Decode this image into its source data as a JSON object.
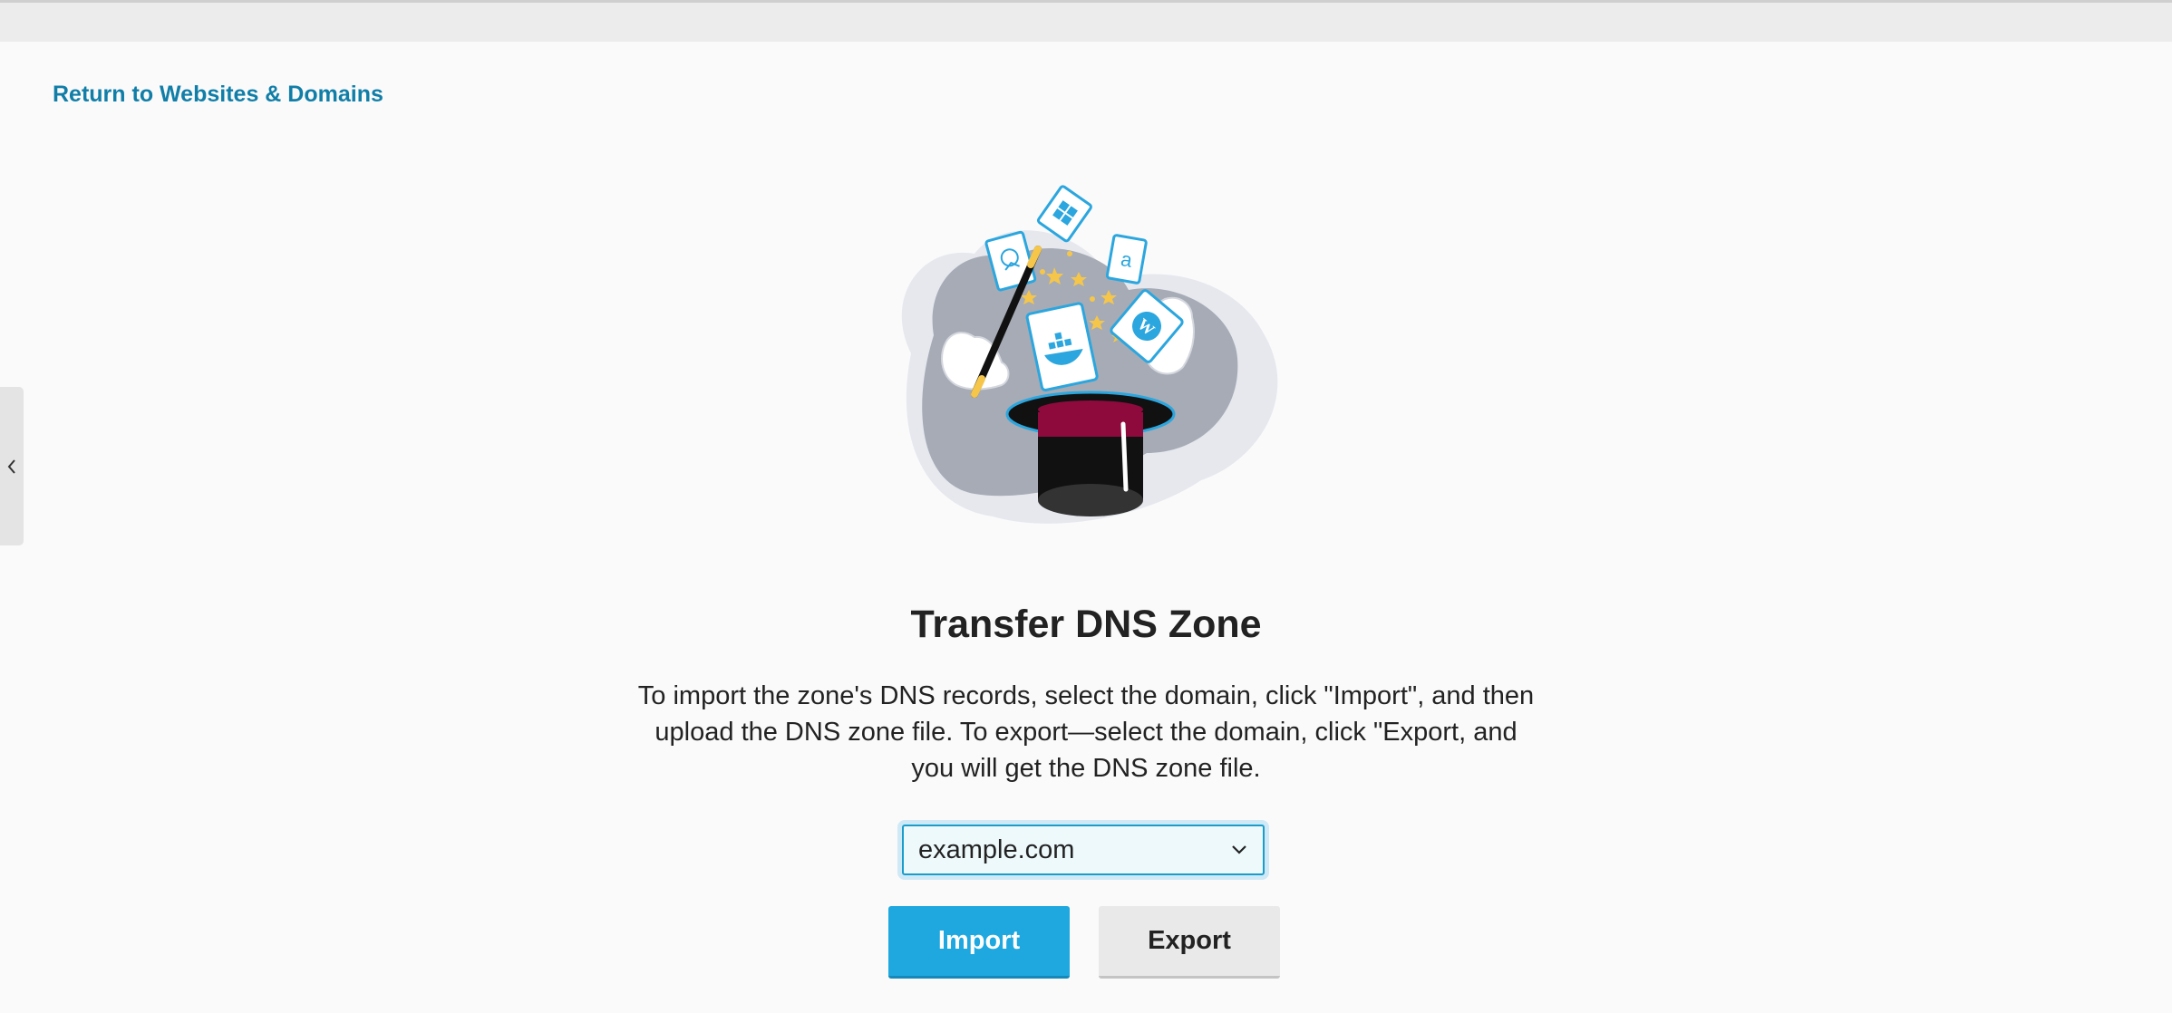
{
  "nav": {
    "back_link": "Return to Websites & Domains",
    "sidebar_toggle_icon": "chevron-left-icon"
  },
  "main": {
    "illustration_icon": "magic-hat-illustration",
    "title": "Transfer DNS Zone",
    "description": "To import the zone's DNS records, select the domain, click \"Import\", and then upload the DNS zone file. To export—select the domain, click \"Export, and you will get the DNS zone file.",
    "domain_select": {
      "selected": "example.com",
      "icon": "chevron-down-icon"
    },
    "buttons": {
      "import_label": "Import",
      "export_label": "Export"
    }
  },
  "colors": {
    "link": "#117ea8",
    "primary_button": "#1ea8df",
    "secondary_button": "#e9e9e9",
    "select_border": "#1a9dc9"
  }
}
